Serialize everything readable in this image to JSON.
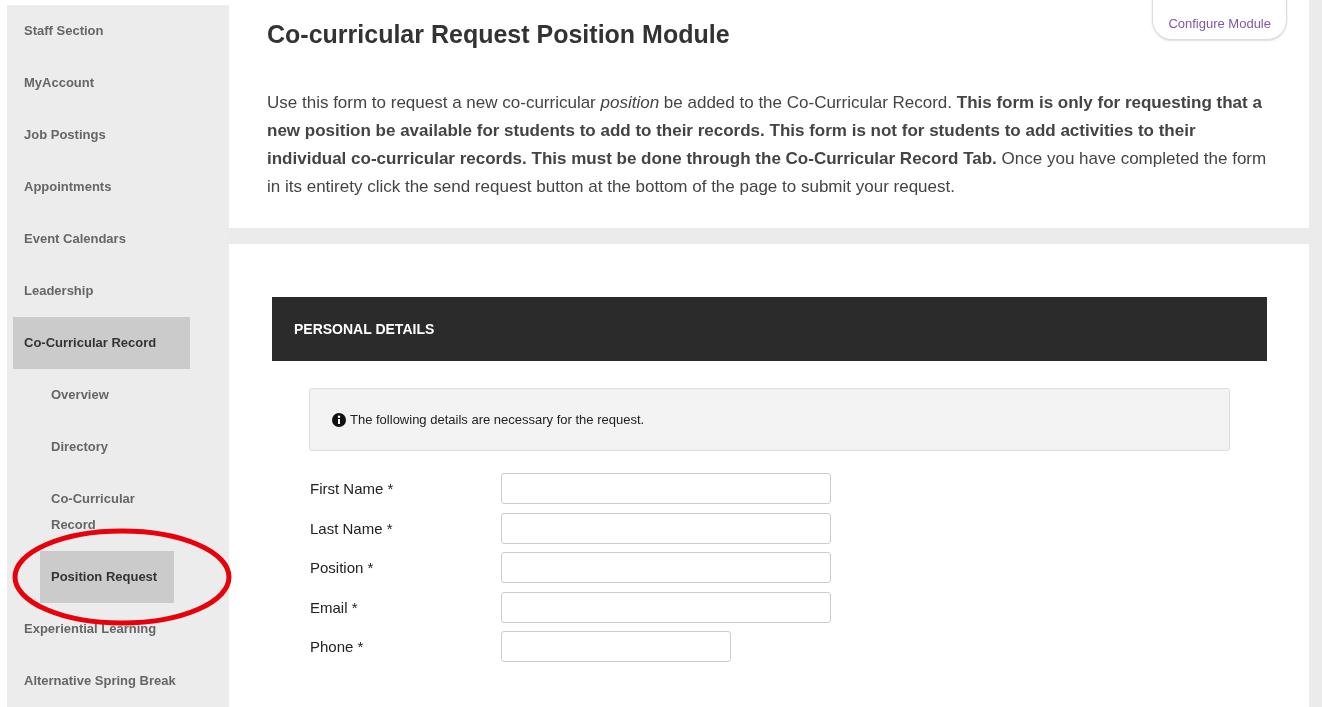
{
  "sidebar": {
    "items": [
      {
        "label": "Staff Section",
        "selected": false
      },
      {
        "label": "MyAccount",
        "selected": false
      },
      {
        "label": "Job Postings",
        "selected": false
      },
      {
        "label": "Appointments",
        "selected": false
      },
      {
        "label": "Event Calendars",
        "selected": false
      },
      {
        "label": "Leadership",
        "selected": false
      },
      {
        "label": "Co-Curricular Record",
        "selected": true,
        "children": [
          {
            "label": "Overview",
            "selected": false
          },
          {
            "label": "Directory",
            "selected": false
          },
          {
            "label": "Co-Curricular Record",
            "selected": false
          },
          {
            "label": "Position Request",
            "selected": true
          }
        ]
      },
      {
        "label": "Experiential Learning",
        "selected": false
      },
      {
        "label": "Alternative Spring Break",
        "selected": false
      }
    ]
  },
  "header": {
    "title": "Co-curricular Request Position Module",
    "configure_button": "Configure Module",
    "intro": "Use this form to request a new co-curricular *position* be added to the Co-Curricular Record. **This form is only for requesting that a new position be available for students to add to their records. This form is not for students to add activities to their individual co-curricular records. This must be done through the Co-Curricular Record Tab.** Once you have completed the form in its entirety click the send request button at the bottom of the page to submit your request."
  },
  "form": {
    "section_title": "PERSONAL DETAILS",
    "notice": "The following details are necessary for the request.",
    "fields": [
      {
        "label": "First Name *",
        "kind": "text"
      },
      {
        "label": "Last Name *",
        "kind": "text"
      },
      {
        "label": "Position *",
        "kind": "text"
      },
      {
        "label": "Email *",
        "kind": "text"
      },
      {
        "label": "Phone *",
        "kind": "phone"
      }
    ]
  }
}
